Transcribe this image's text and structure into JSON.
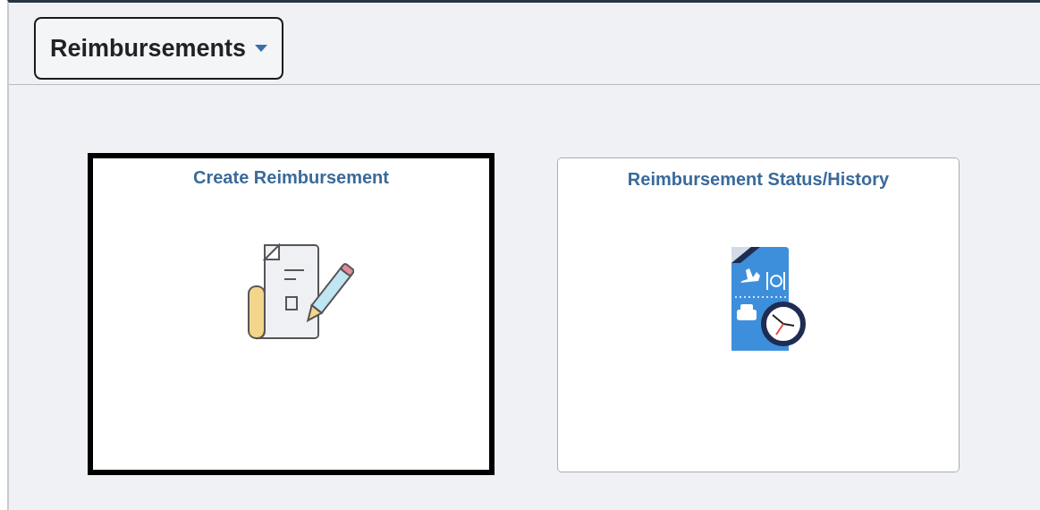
{
  "header": {
    "menu_button": "Reimbursements"
  },
  "tiles": [
    {
      "title": "Create Reimbursement",
      "kind": "create",
      "selected": true
    },
    {
      "title": "Reimbursement Status/History",
      "kind": "history",
      "selected": false
    }
  ]
}
